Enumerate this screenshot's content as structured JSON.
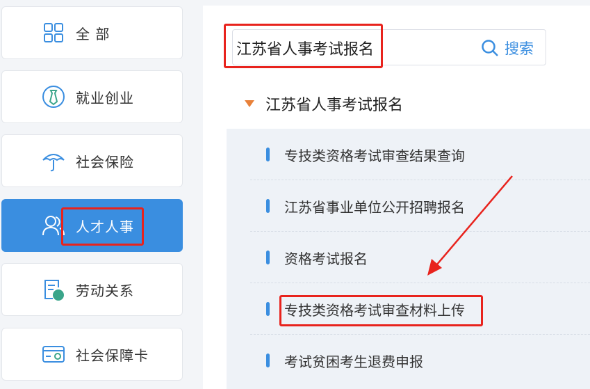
{
  "sidebar": {
    "items": [
      {
        "label": "全 部",
        "icon": "grid-icon"
      },
      {
        "label": "就业创业",
        "icon": "tie-icon"
      },
      {
        "label": "社会保险",
        "icon": "umbrella-icon"
      },
      {
        "label": "人才人事",
        "icon": "users-icon",
        "active": true
      },
      {
        "label": "劳动关系",
        "icon": "document-star-icon"
      },
      {
        "label": "社会保障卡",
        "icon": "card-icon"
      }
    ]
  },
  "search": {
    "query": "江苏省人事考试报名",
    "button_label": "搜索"
  },
  "section": {
    "title": "江苏省人事考试报名"
  },
  "services": [
    {
      "label": "专技类资格考试审查结果查询"
    },
    {
      "label": "江苏省事业单位公开招聘报名"
    },
    {
      "label": "资格考试报名"
    },
    {
      "label": "专技类资格考试审查材料上传"
    },
    {
      "label": "考试贫困考生退费申报"
    }
  ],
  "colors": {
    "accent": "#3a8ee0",
    "annotation": "#e8231d",
    "triangle": "#e8813a"
  }
}
